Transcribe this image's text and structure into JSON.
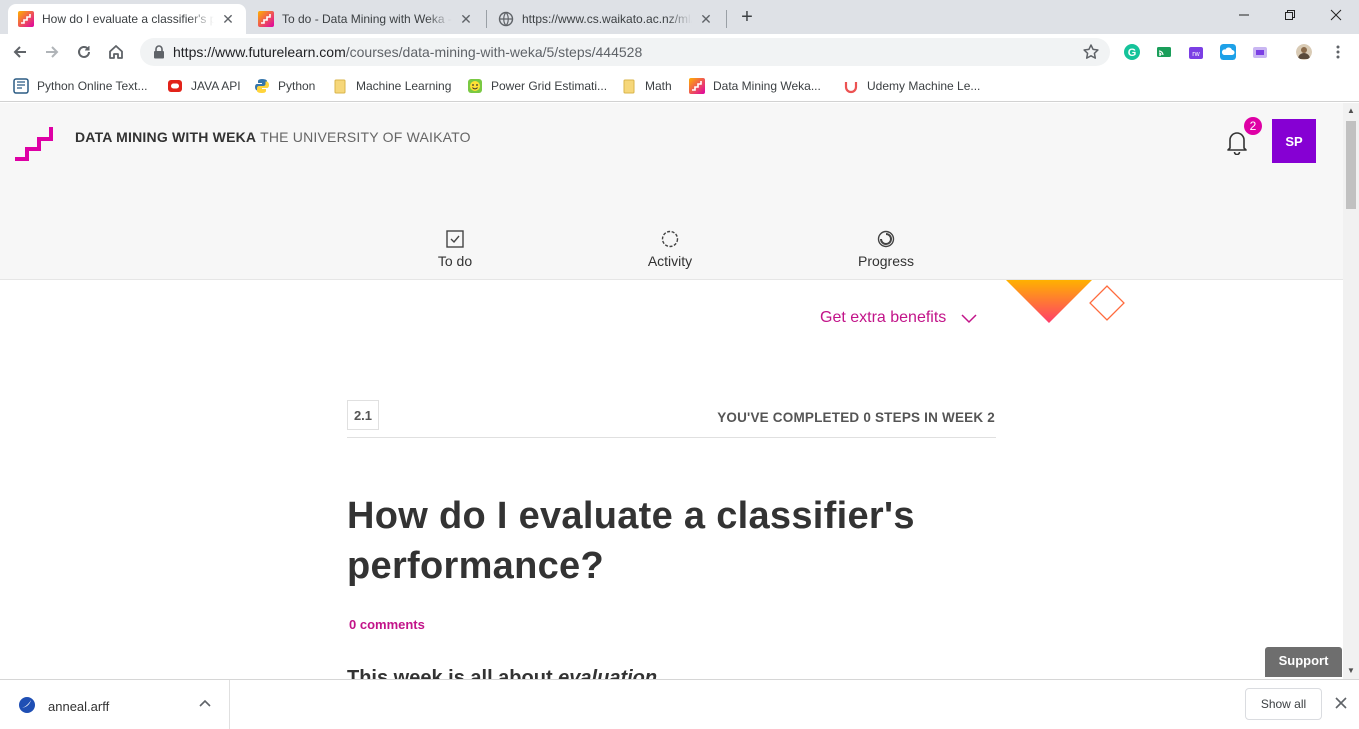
{
  "browser": {
    "tabs": [
      {
        "title": "How do I evaluate a classifier's pe",
        "active": true,
        "favicon": "futurelearn-icon"
      },
      {
        "title": "To do - Data Mining with Weka - ",
        "active": false,
        "favicon": "futurelearn-icon"
      },
      {
        "title": "https://www.cs.waikato.ac.nz/ml/",
        "active": false,
        "favicon": "globe-icon"
      }
    ],
    "url_host": "https://www.futurelearn.com",
    "url_path": "/courses/data-mining-with-weka/5/steps/444528",
    "bookmarks": [
      {
        "label": "Python Online Text...",
        "icon": "book-icon",
        "color": "#2b5b84"
      },
      {
        "label": "JAVA API",
        "icon": "oracle-icon",
        "color": "#e2231a"
      },
      {
        "label": "Python",
        "icon": "python-icon",
        "color": "#3776ab"
      },
      {
        "label": "Machine Learning",
        "icon": "folder-icon",
        "color": "#f6d77a"
      },
      {
        "label": "Power Grid Estimati...",
        "icon": "smiley-icon",
        "color": "#7ac943"
      },
      {
        "label": "Math",
        "icon": "folder-icon",
        "color": "#f6d77a"
      },
      {
        "label": "Data Mining Weka...",
        "icon": "futurelearn-icon",
        "color": "#de00a5"
      },
      {
        "label": "Udemy Machine Le...",
        "icon": "udemy-icon",
        "color": "#ec5252"
      }
    ]
  },
  "site": {
    "course_name": "DATA MINING WITH WEKA",
    "university": "THE UNIVERSITY OF WAIKATO",
    "notification_count": "2",
    "avatar_initials": "SP",
    "nav": [
      {
        "label": "To do",
        "icon": "checkbox-icon"
      },
      {
        "label": "Activity",
        "icon": "activity-icon"
      },
      {
        "label": "Progress",
        "icon": "progress-icon"
      }
    ],
    "benefits_label": "Get extra benefits",
    "accent_color": "#c21489"
  },
  "step": {
    "number": "2.1",
    "completed_text": "YOU'VE COMPLETED 0 STEPS IN WEEK 2",
    "title": "How do I evaluate a classifier's performance?",
    "comments": "0 comments",
    "intro_prefix": "This week is all about ",
    "intro_emph": "evaluation"
  },
  "support_label": "Support",
  "download": {
    "filename": "anneal.arff",
    "show_all": "Show all"
  }
}
